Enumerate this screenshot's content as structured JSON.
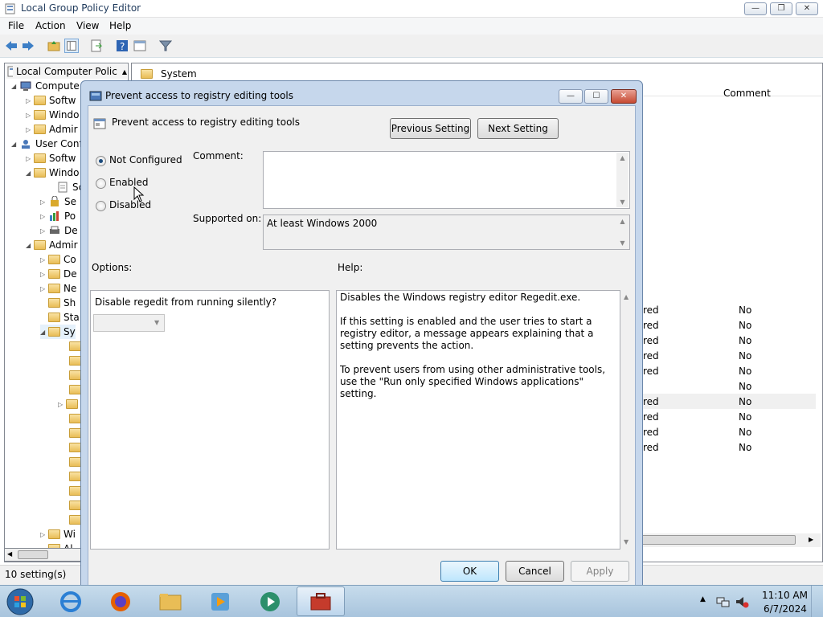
{
  "main_window": {
    "title": "Local Group Policy Editor",
    "menu": [
      "File",
      "Action",
      "View",
      "Help"
    ],
    "status": "10 setting(s)"
  },
  "tree": {
    "items": [
      {
        "label": "Local Computer Polic",
        "level": 0
      },
      {
        "label": "Compute",
        "level": 1
      },
      {
        "label": "Softw",
        "level": 2
      },
      {
        "label": "Windo",
        "level": 2
      },
      {
        "label": "Admir",
        "level": 2
      },
      {
        "label": "User Conf",
        "level": 1
      },
      {
        "label": "Softw",
        "level": 2
      },
      {
        "label": "Windo",
        "level": 2
      },
      {
        "label": "Sc",
        "level": 3
      },
      {
        "label": "Se",
        "level": 3
      },
      {
        "label": "Po",
        "level": 3
      },
      {
        "label": "De",
        "level": 3
      },
      {
        "label": "Admir",
        "level": 2
      },
      {
        "label": "Co",
        "level": 3
      },
      {
        "label": "De",
        "level": 3
      },
      {
        "label": "Ne",
        "level": 3
      },
      {
        "label": "Sh",
        "level": 3
      },
      {
        "label": "Sta",
        "level": 3
      },
      {
        "label": "Sy",
        "level": 3
      },
      {
        "label": "Wi",
        "level": 3
      },
      {
        "label": "Al",
        "level": 3
      }
    ]
  },
  "right_pane": {
    "breadcrumb": "System",
    "comment_header": "Comment",
    "rows": [
      {
        "state": "red",
        "comment": "No"
      },
      {
        "state": "red",
        "comment": "No"
      },
      {
        "state": "red",
        "comment": "No"
      },
      {
        "state": "red",
        "comment": "No"
      },
      {
        "state": "red",
        "comment": "No"
      },
      {
        "state": "",
        "comment": "No"
      },
      {
        "state": "red",
        "comment": "No"
      },
      {
        "state": "red",
        "comment": "No"
      },
      {
        "state": "red",
        "comment": "No"
      },
      {
        "state": "red",
        "comment": "No"
      }
    ]
  },
  "dialog": {
    "title": "Prevent access to registry editing tools",
    "setting_name": "Prevent access to registry editing tools",
    "previous_setting": "Previous Setting",
    "next_setting": "Next Setting",
    "radio": {
      "not_configured": "Not Configured",
      "enabled": "Enabled",
      "disabled": "Disabled",
      "selected": "not_configured"
    },
    "comment_label": "Comment:",
    "comment_value": "",
    "supported_label": "Supported on:",
    "supported_value": "At least Windows 2000",
    "options_label": "Options:",
    "help_label": "Help:",
    "option_text": "Disable regedit from running silently?",
    "option_dropdown_value": "",
    "help_text": [
      "Disables the Windows registry editor Regedit.exe.",
      "If this setting is enabled and the user tries to start a registry editor, a message appears explaining that a setting prevents the action.",
      "To prevent users from using other administrative tools, use the \"Run only specified Windows applications\" setting."
    ],
    "ok": "OK",
    "cancel": "Cancel",
    "apply": "Apply"
  },
  "taskbar": {
    "time": "11:10 AM",
    "date": "6/7/2024"
  }
}
